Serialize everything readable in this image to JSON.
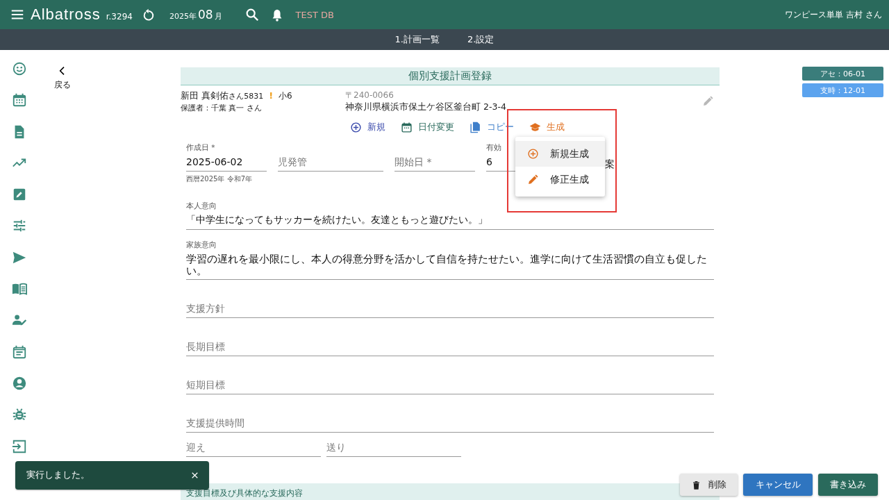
{
  "app_bar": {
    "brand": "Albatross",
    "version": "r.3294",
    "year": "2025",
    "year_unit": "年",
    "month": "08",
    "month_unit": "月",
    "db_label": "TEST DB",
    "user": "ワンピース単単 吉村 さん"
  },
  "nav_tabs": [
    {
      "label": "1.計画一覧"
    },
    {
      "label": "2.設定"
    }
  ],
  "sidebar": {
    "items": [
      {
        "kind": "smiley"
      },
      {
        "kind": "calendar"
      },
      {
        "kind": "document"
      },
      {
        "kind": "trend"
      },
      {
        "kind": "edit"
      },
      {
        "kind": "sliders"
      },
      {
        "kind": "send"
      },
      {
        "kind": "book"
      },
      {
        "kind": "person_edit"
      },
      {
        "kind": "event_note"
      },
      {
        "kind": "account"
      },
      {
        "kind": "bug"
      },
      {
        "kind": "login"
      }
    ]
  },
  "back": {
    "label": "戻る"
  },
  "badges": [
    {
      "label": "アセ：06-01",
      "color": "#3a7d7b"
    },
    {
      "label": "支時：12-01",
      "color": "#5ba3ee"
    }
  ],
  "form": {
    "title": "個別支援計画登録",
    "child": {
      "name": "新田 真剣佑",
      "honorific": "さん",
      "id": "5831",
      "warning": "!",
      "grade": "小6",
      "guardian": "保護者：千葉 真一 さん",
      "postal": "〒240-0066",
      "address": "神奈川県横浜市保土ケ谷区釜台町 2-3-4"
    },
    "actions": [
      {
        "kind": "add",
        "label": "新規",
        "color": "#3949ab"
      },
      {
        "kind": "date",
        "label": "日付変更",
        "color": "#2a6a5c"
      },
      {
        "kind": "copy",
        "label": "コピー",
        "color": "#3f7fca"
      },
      {
        "kind": "generate",
        "label": "生成",
        "color": "#e07020"
      }
    ],
    "generate_menu": [
      {
        "kind": "add",
        "label": "新規生成",
        "selected": true
      },
      {
        "kind": "edit",
        "label": "修正生成",
        "selected": false
      }
    ],
    "top_fields": [
      {
        "label": "作成日 *",
        "value": "2025-06-02",
        "hint": "西暦2025年 令和7年"
      },
      {
        "placeholder": "児発管"
      },
      {
        "placeholder": "開始日 *"
      },
      {
        "label": "有効",
        "value": "6"
      }
    ],
    "trailing_text": "案",
    "fields": [
      {
        "kind": "single",
        "label": "本人意向",
        "value": "「中学生になってもサッカーを続けたい。友達ともっと遊びたい。」"
      },
      {
        "kind": "multi",
        "label": "家族意向",
        "value": "学習の遅れを最小限にし、本人の得意分野を活かして自信を持たせたい。進学に向けて生活習慣の自立も促したい。"
      },
      {
        "kind": "single",
        "placeholder": "支援方針"
      },
      {
        "kind": "single",
        "placeholder": "長期目標"
      },
      {
        "kind": "single",
        "placeholder": "短期目標"
      },
      {
        "kind": "single",
        "placeholder": "支援提供時間"
      }
    ],
    "transport": [
      {
        "placeholder": "迎え"
      },
      {
        "placeholder": "送り"
      }
    ],
    "section": "支援目標及び具体的な支援内容"
  },
  "footer_buttons": [
    {
      "kind": "delete",
      "label": "削除"
    },
    {
      "kind": "cancel",
      "label": "キャンセル"
    },
    {
      "kind": "save",
      "label": "書き込み"
    }
  ],
  "toast": {
    "message": "実行しました。"
  }
}
